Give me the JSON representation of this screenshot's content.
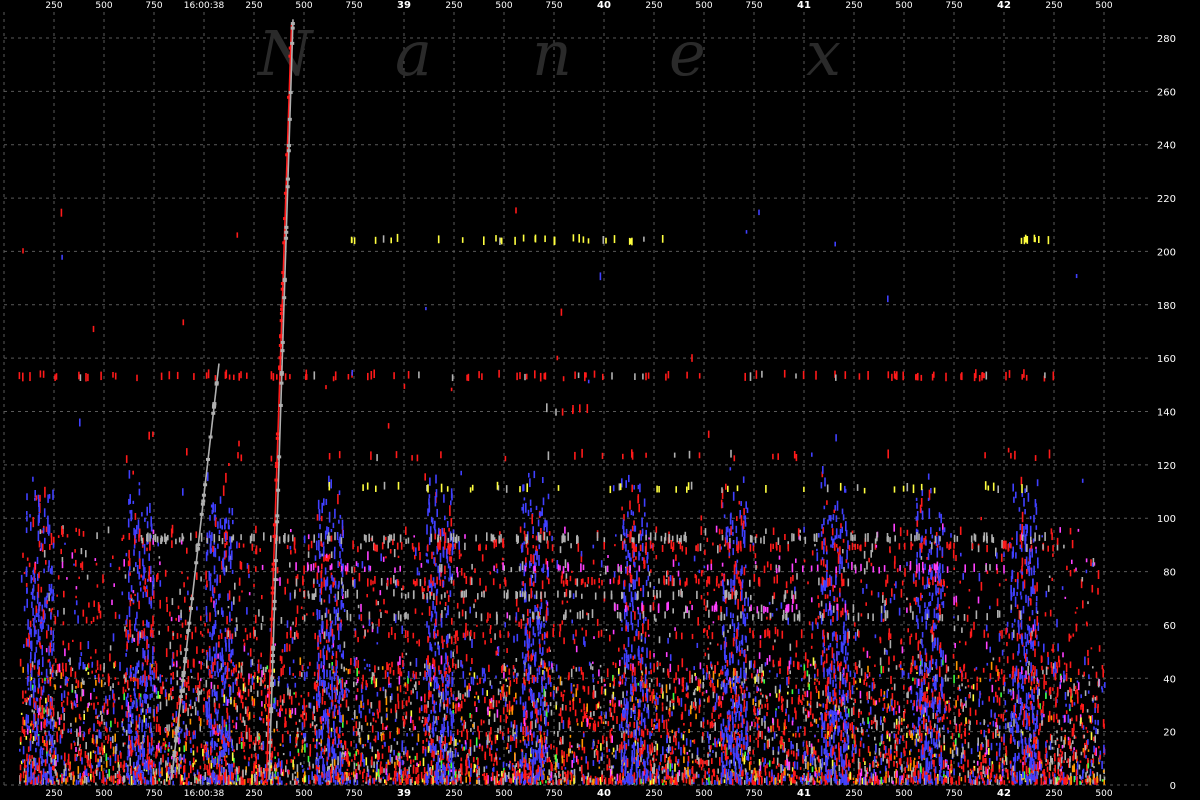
{
  "chart_data": {
    "type": "scatter",
    "watermark": [
      "N",
      "a",
      "n",
      "e",
      "x"
    ],
    "x_tick_labels": [
      "250",
      "500",
      "750",
      "16:00:38",
      "250",
      "500",
      "750",
      "39",
      "250",
      "500",
      "750",
      "40",
      "250",
      "500",
      "750",
      "41",
      "250",
      "500",
      "750",
      "42",
      "250",
      "500"
    ],
    "x_tick_bold": [
      false,
      false,
      false,
      false,
      false,
      false,
      false,
      true,
      false,
      false,
      false,
      true,
      false,
      false,
      false,
      true,
      false,
      false,
      false,
      true,
      false,
      false
    ],
    "y_ticks": [
      0,
      20,
      40,
      60,
      80,
      100,
      120,
      140,
      160,
      180,
      200,
      220,
      240,
      260,
      280
    ],
    "ylim": [
      0,
      290
    ],
    "xlim": [
      0,
      22
    ],
    "grid": true,
    "colors": {
      "background": "#000000",
      "grid": "#5a5a5a",
      "text": "#ffffff",
      "watermark": "#2a2a2a",
      "series": [
        "#ff1a1a",
        "#4040ff",
        "#b0b0b0",
        "#ffff40",
        "#ff9900",
        "#40ff40",
        "#ff40ff",
        "#40c0c0"
      ]
    },
    "spikes": [
      {
        "x0": 3.35,
        "y0": 2,
        "x1": 4.3,
        "y1": 158,
        "color": "#b0b0b0"
      },
      {
        "x0": 5.25,
        "y0": 2,
        "x1": 5.75,
        "y1": 285,
        "color": "#ff1a1a"
      },
      {
        "x0": 5.3,
        "y0": 2,
        "x1": 5.78,
        "y1": 287,
        "color": "#b0b0b0"
      }
    ],
    "horizontal_bands": [
      {
        "y": 203,
        "x0": 6.6,
        "x1": 13.2,
        "color": "#ffff40",
        "density": 0.3
      },
      {
        "y": 203,
        "x0": 20.3,
        "x1": 20.9,
        "color": "#ffff40",
        "density": 0.8
      },
      {
        "y": 152,
        "x0": 0.2,
        "x1": 21.0,
        "color": "#ff1a1a",
        "density": 0.35
      },
      {
        "y": 139,
        "x0": 10.8,
        "x1": 11.8,
        "color": "#ff1a1a",
        "density": 0.4
      },
      {
        "y": 122,
        "x0": 2.9,
        "x1": 21.0,
        "color": "#ff1a1a",
        "density": 0.12
      },
      {
        "y": 110,
        "x0": 6.4,
        "x1": 21.0,
        "color": "#ffff40",
        "density": 0.2
      },
      {
        "y": 91,
        "x0": 2.6,
        "x1": 21.0,
        "color": "#b0b0b0",
        "density": 0.55
      },
      {
        "y": 88,
        "x0": 5.8,
        "x1": 21.0,
        "color": "#ff1a1a",
        "density": 0.4
      },
      {
        "y": 80,
        "x0": 5.8,
        "x1": 20.0,
        "color": "#ff40ff",
        "density": 0.35
      },
      {
        "y": 75,
        "x0": 5.6,
        "x1": 19.0,
        "color": "#ff1a1a",
        "density": 0.45
      },
      {
        "y": 70,
        "x0": 5.6,
        "x1": 16.3,
        "color": "#b0b0b0",
        "density": 0.45
      },
      {
        "y": 65,
        "x0": 12.0,
        "x1": 17.0,
        "color": "#ff40ff",
        "density": 0.5
      },
      {
        "y": 62,
        "x0": 5.8,
        "x1": 20.5,
        "color": "#b0b0b0",
        "density": 0.35
      },
      {
        "y": 55,
        "x0": 2.2,
        "x1": 21.0,
        "color": "#ff1a1a",
        "density": 0.3
      }
    ],
    "dense_columns_blue": [
      0.7,
      2.7,
      4.3,
      6.5,
      8.7,
      10.6,
      12.6,
      14.6,
      16.6,
      18.5,
      20.4
    ],
    "band_floor": {
      "y0": 0,
      "y1": 45
    },
    "band_mid": {
      "y0": 20,
      "y1": 95
    }
  }
}
